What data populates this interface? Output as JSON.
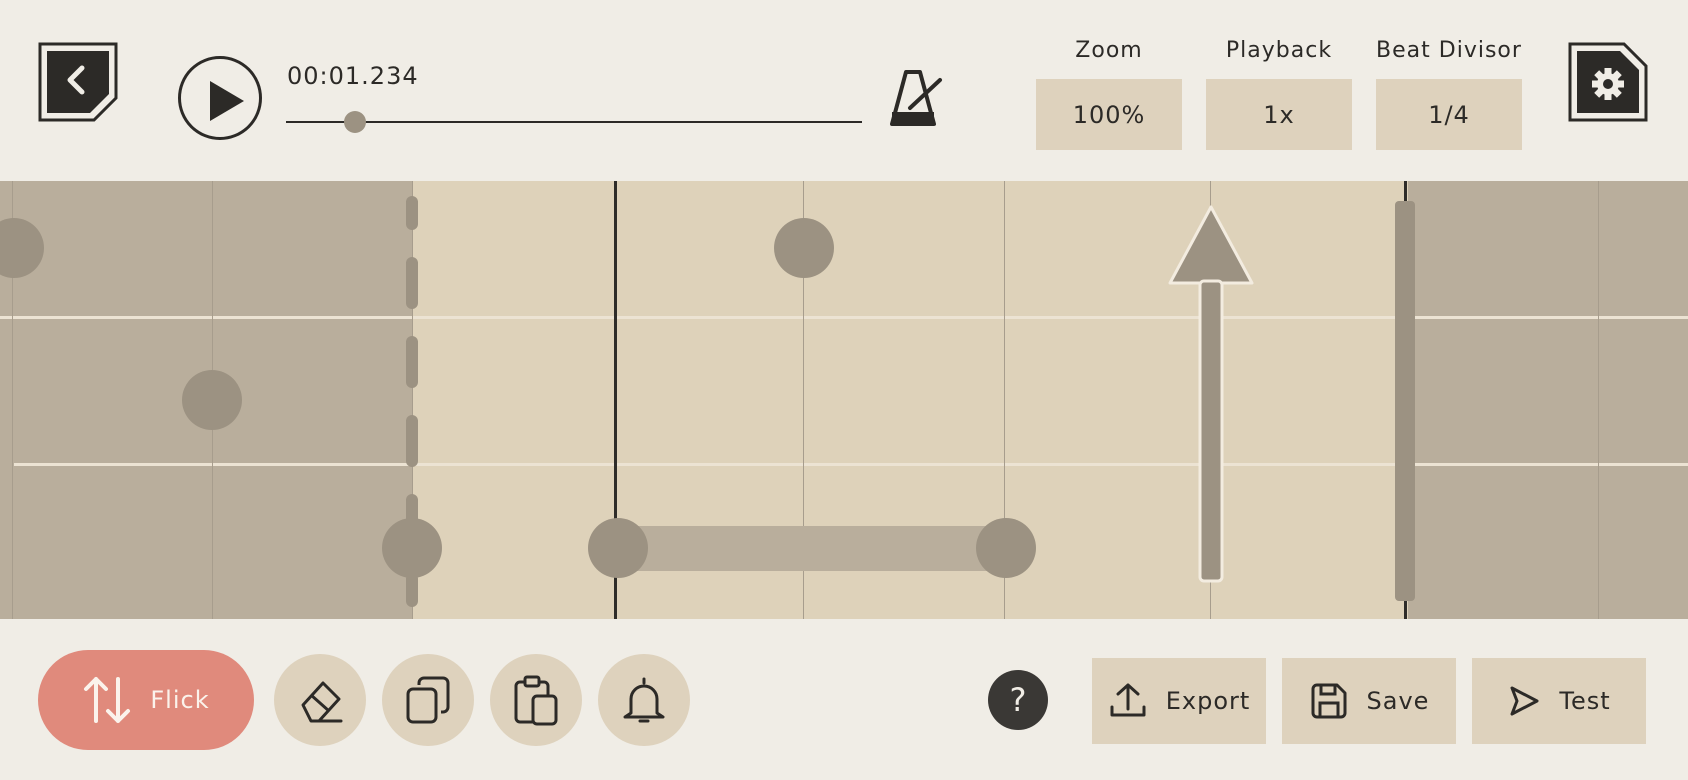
{
  "header": {
    "time": "00:01.234",
    "playback_progress": 0.12,
    "controls": [
      {
        "label": "Zoom",
        "value": "100%"
      },
      {
        "label": "Playback",
        "value": "1x"
      },
      {
        "label": "Beat Divisor",
        "value": "1/4"
      }
    ]
  },
  "toolbar": {
    "flick_label": "Flick",
    "help_label": "?",
    "export_label": "Export",
    "save_label": "Save",
    "test_label": "Test"
  },
  "icons": {
    "back": "back-arrow-icon",
    "play": "play-icon",
    "metronome": "metronome-icon",
    "settings": "gear-icon",
    "flick": "flick-arrows-icon",
    "eraser": "eraser-icon",
    "copy": "copy-icon",
    "paste": "clipboard-icon",
    "bell": "bell-icon",
    "export": "upload-icon",
    "save": "floppy-disk-icon",
    "test": "play-outline-icon"
  },
  "colors": {
    "background": "#f0ede6",
    "lane": "#ded2ba",
    "lane_shaded": "#b9ae9c",
    "note": "#9c9282",
    "accent": "#e08a7c",
    "dark": "#2c2a27"
  }
}
